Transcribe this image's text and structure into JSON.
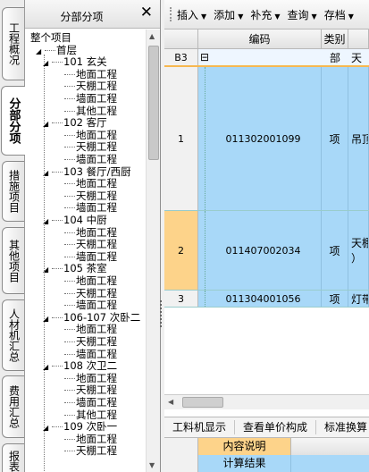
{
  "side_tabs": [
    "工程概况",
    "分部分项",
    "措施项目",
    "其他项目",
    "人材机汇总",
    "费用汇总",
    "报表"
  ],
  "tree_panel": {
    "title": "分部分项",
    "close": "✕",
    "root": "整个项目",
    "level1": "首层",
    "rooms": [
      {
        "label": "101 玄关",
        "children": [
          "地面工程",
          "天棚工程",
          "墙面工程",
          "其他工程"
        ]
      },
      {
        "label": "102 客厅",
        "children": [
          "地面工程",
          "天棚工程",
          "墙面工程"
        ]
      },
      {
        "label": "103 餐厅/西厨",
        "children": [
          "地面工程",
          "天棚工程",
          "墙面工程"
        ]
      },
      {
        "label": "104 中厨",
        "children": [
          "地面工程",
          "天棚工程",
          "墙面工程"
        ]
      },
      {
        "label": "105 茶室",
        "children": [
          "地面工程",
          "天棚工程",
          "墙面工程"
        ]
      },
      {
        "label": "106-107 次卧二",
        "children": [
          "地面工程",
          "天棚工程",
          "墙面工程"
        ]
      },
      {
        "label": "108 次卫二",
        "children": [
          "地面工程",
          "天棚工程",
          "墙面工程",
          "其他工程"
        ]
      },
      {
        "label": "109 次卧一",
        "children": [
          "地面工程",
          "天棚工程"
        ]
      }
    ]
  },
  "toolbar": [
    {
      "label": "插入",
      "arrow": "▼"
    },
    {
      "label": "添加",
      "arrow": "▼"
    },
    {
      "label": "补充",
      "arrow": "▼"
    },
    {
      "label": "查询",
      "arrow": "▼"
    },
    {
      "label": "存档",
      "arrow": "▼"
    }
  ],
  "grid": {
    "headers": [
      "编码",
      "类别"
    ],
    "group_row": {
      "num": "B3",
      "toggle": "⊟",
      "type": "部",
      "name": "天棚"
    },
    "rows": [
      {
        "num": "1",
        "code": "011302001099",
        "type": "项",
        "name": "吊顶"
      },
      {
        "num": "2",
        "code": "011407002034",
        "type": "项",
        "name": "天棚\n）"
      },
      {
        "num": "3",
        "code": "011304001056",
        "type": "项",
        "name": "灯带"
      }
    ]
  },
  "bottom_tabs": [
    "工料机显示",
    "查看单价构成",
    "标准换算"
  ],
  "bottom_grid": {
    "header": "内容说明",
    "row1": "计算结果"
  },
  "colors": {
    "selected": "#a8d8f8",
    "current_row": "#fdd38a",
    "header_bottom": "#fdd38a"
  }
}
